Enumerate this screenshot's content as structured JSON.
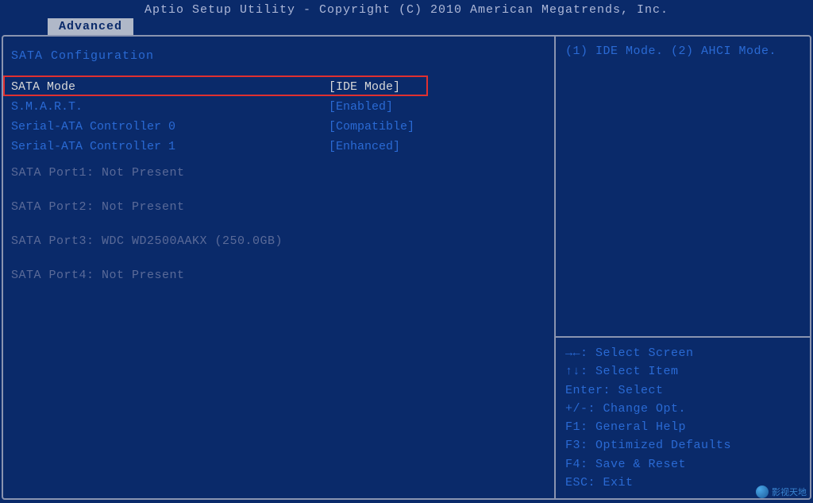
{
  "title": "Aptio Setup Utility - Copyright (C) 2010 American Megatrends, Inc.",
  "tabs": {
    "advanced": "Advanced"
  },
  "section_title": "SATA Configuration",
  "items": [
    {
      "label": "SATA Mode",
      "value": "[IDE Mode]",
      "selected": true
    },
    {
      "label": "S.M.A.R.T.",
      "value": "[Enabled]",
      "selected": false
    },
    {
      "label": "Serial-ATA Controller 0",
      "value": "[Compatible]",
      "selected": false
    },
    {
      "label": "Serial-ATA Controller 1",
      "value": "[Enhanced]",
      "selected": false
    }
  ],
  "ports": [
    "SATA Port1: Not Present",
    "SATA Port2: Not Present",
    "SATA Port3: WDC WD2500AAKX (250.0GB)",
    "SATA Port4: Not Present"
  ],
  "help_text": "(1) IDE Mode. (2) AHCI Mode.",
  "keys": [
    "→←: Select Screen",
    "↑↓: Select Item",
    "Enter: Select",
    "+/-: Change Opt.",
    "F1: General Help",
    "F3: Optimized Defaults",
    "F4: Save & Reset",
    "ESC: Exit"
  ],
  "watermark": "影视天地"
}
